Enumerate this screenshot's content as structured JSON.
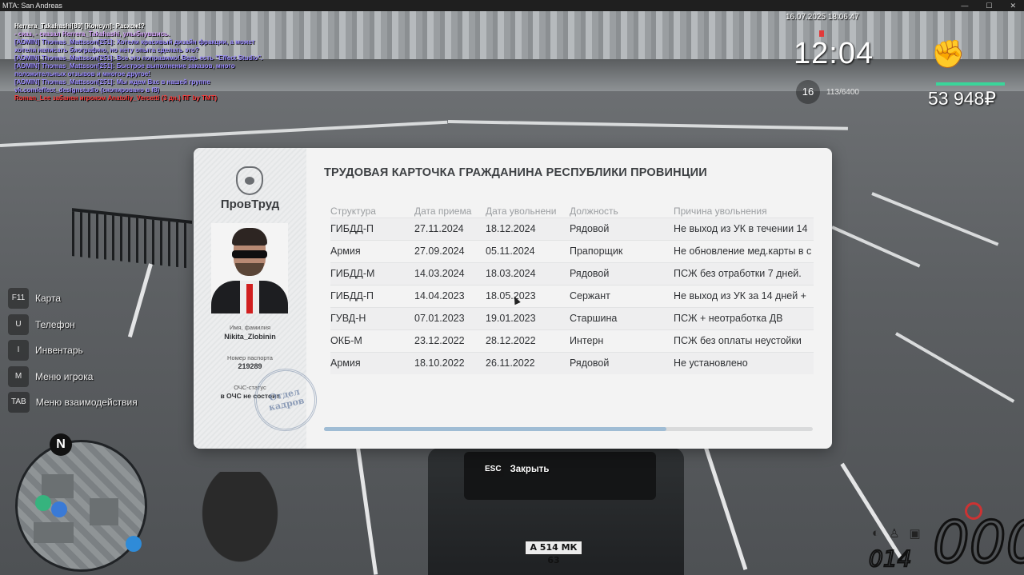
{
  "window": {
    "title": "MTA: San Andreas",
    "controls": [
      "—",
      "☐",
      "✕"
    ]
  },
  "chat": [
    {
      "text": "Herrera_Takahashi[89] [Консул]: Расхож!?",
      "color": "#ffffff"
    },
    {
      "text": "- сказ, - сказал Herrera_Takahashi, улыбнувшись.",
      "color": "#d9a8ff"
    },
    {
      "text": "[ADMIN] Thomas_Mattsson[251]: Хотели красивый дизайн фракции, а может хотели написать биографию, но нету опыта сделать это?",
      "color": "#9b8cff"
    },
    {
      "text": "[ADMIN] Thomas_Mattsson[251]: Все это поправимо! Ведь есть \"Effect Studio\".",
      "color": "#9b8cff"
    },
    {
      "text": "[ADMIN] Thomas_Mattsson[251]: Быстрое выполнение заказов, много положительных отзывов и многое другое!",
      "color": "#9b8cff"
    },
    {
      "text": "[ADMIN] Thomas_Mattsson[251]: Мы ждем Вас в нашей группе vk.com/effect_designstudio (скопировано в f8)",
      "color": "#9b8cff"
    },
    {
      "text": "Roman_Lee забанен игроком Anatoliy_Vercetti (3 дн.) ПГ by TMT)",
      "color": "#ff3a3a"
    }
  ],
  "hud": {
    "datetime": "16.07.2025 18:06:47",
    "time": "12:04",
    "level": "16",
    "xp": "113/6400",
    "money": "53 948₽",
    "fist_icon": "fist-icon",
    "bar_color": "#3ad59a"
  },
  "binds": [
    {
      "key": "F11",
      "label": "Карта"
    },
    {
      "key": "U",
      "label": "Телефон"
    },
    {
      "key": "I",
      "label": "Инвентарь"
    },
    {
      "key": "M",
      "label": "Меню игрока"
    },
    {
      "key": "TAB",
      "label": "Меню взаимодействия"
    }
  ],
  "minimap": {
    "north": "N"
  },
  "vehicle": {
    "plate": "А 514 МК 63",
    "speed": "000",
    "fuel": "014"
  },
  "card": {
    "org": "ПровТруд",
    "name_label": "Имя, фамилия",
    "name": "Nikita_Zlobinin",
    "passport_label": "Номер паспорта",
    "passport": "219289",
    "status_label": "ОЧС-статус",
    "status": "в ОЧС не состоит",
    "stamp": "Отдел кадров",
    "title": "ТРУДОВАЯ КАРТОЧКА ГРАЖДАНИНА РЕСПУБЛИКИ ПРОВИНЦИИ",
    "columns": [
      "Структура",
      "Дата приема",
      "Дата увольнени",
      "Должность",
      "Причина увольнения"
    ],
    "rows": [
      [
        "ГИБДД-П",
        "27.11.2024",
        "18.12.2024",
        "Рядовой",
        "Не выход из УК в течении 14"
      ],
      [
        "Армия",
        "27.09.2024",
        "05.11.2024",
        "Прапорщик",
        "Не обновление мед.карты в с"
      ],
      [
        "ГИБДД-М",
        "14.03.2024",
        "18.03.2024",
        "Рядовой",
        "ПСЖ без отработки 7 дней."
      ],
      [
        "ГИБДД-П",
        "14.04.2023",
        "18.05.2023",
        "Сержант",
        "Не выход из УК за 14 дней +"
      ],
      [
        "ГУВД-Н",
        "07.01.2023",
        "19.01.2023",
        "Старшина",
        "ПСЖ + неотработка ДВ"
      ],
      [
        "ОКБ-М",
        "23.12.2022",
        "28.12.2022",
        "Интерн",
        "ПСЖ без оплаты неустойки"
      ],
      [
        "Армия",
        "18.10.2022",
        "26.11.2022",
        "Рядовой",
        "Не установлено"
      ]
    ],
    "scroll_fraction": 0.7
  },
  "close": {
    "key": "ESC",
    "label": "Закрыть"
  }
}
